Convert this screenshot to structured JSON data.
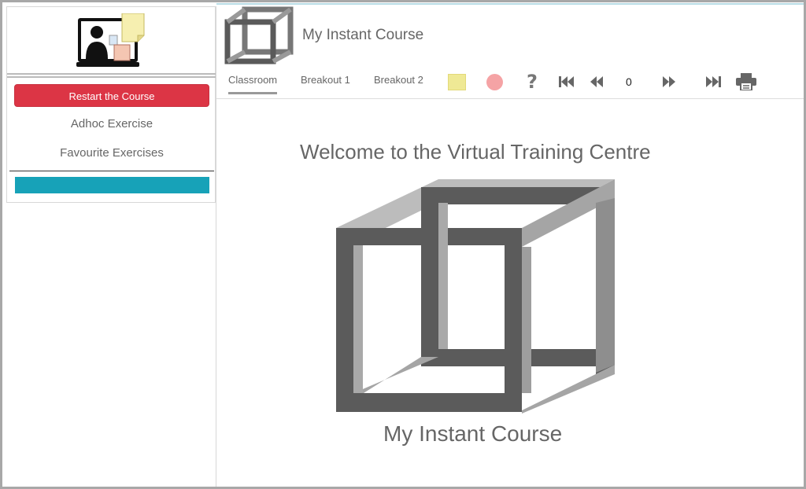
{
  "app": {
    "title": "My Instant Course"
  },
  "sidebar": {
    "restart_label": "Restart the Course",
    "links": [
      {
        "label": "Adhoc Exercise"
      },
      {
        "label": "Favourite Exercises"
      }
    ],
    "accent_color": "#17a2b8",
    "restart_color": "#dc3545"
  },
  "toolbar": {
    "tabs": [
      {
        "label": "Classroom",
        "active": true
      },
      {
        "label": "Breakout 1",
        "active": false
      },
      {
        "label": "Breakout 2",
        "active": false
      }
    ],
    "help_glyph": "?",
    "counter": "0",
    "icons": [
      "yellow-note-icon",
      "red-dot-icon",
      "help-icon",
      "first-icon",
      "previous-icon",
      "next-icon",
      "last-icon",
      "print-icon"
    ]
  },
  "main": {
    "welcome": "Welcome to the Virtual Training Centre",
    "course_name": "My Instant Course"
  }
}
